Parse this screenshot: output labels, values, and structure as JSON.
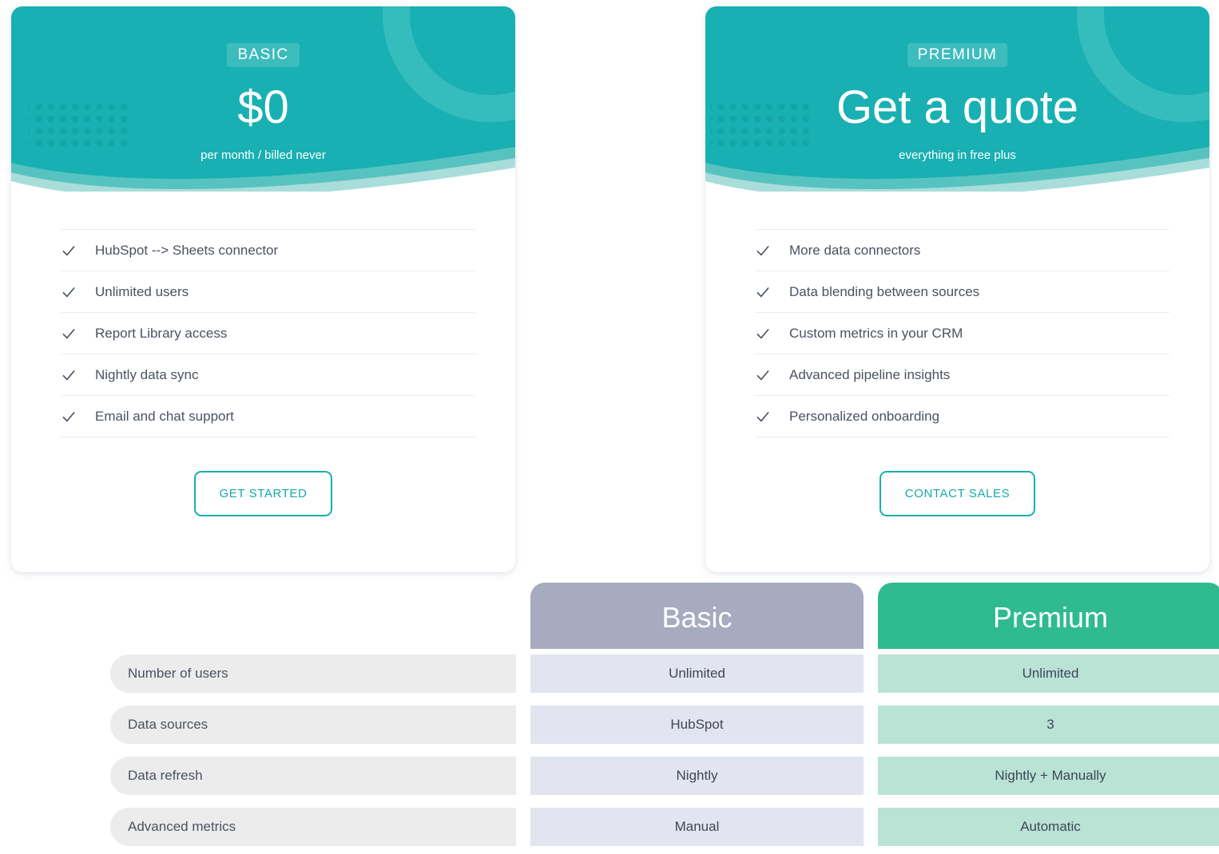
{
  "theme": {
    "teal": "#18b0b2",
    "teal_dark": "#139fa1",
    "teal_mid": "#57c3c0",
    "teal_light": "#a8ddda",
    "gray_header": "#a7abc0",
    "green_header": "#2fba90",
    "basic_cell": "#e2e5ef",
    "premium_cell": "#b9e3d5",
    "label_cell": "#ececec",
    "text": "#4a5260"
  },
  "plans": [
    {
      "id": "basic",
      "badge": "BASIC",
      "price": "$0",
      "subtitle": "per month / billed never",
      "features": [
        "HubSpot --> Sheets connector",
        "Unlimited users",
        "Report Library access",
        "Nightly data sync",
        "Email and chat support"
      ],
      "cta": "GET STARTED",
      "check_icon": "check-icon"
    },
    {
      "id": "premium",
      "badge": "PREMIUM",
      "price": "Get a quote",
      "subtitle": "everything in free plus",
      "features": [
        "More data connectors",
        "Data blending between sources",
        "Custom metrics in your CRM",
        "Advanced pipeline insights",
        "Personalized onboarding"
      ],
      "cta": "CONTACT SALES",
      "check_icon": "check-icon"
    }
  ],
  "comparison": {
    "columns": [
      "Basic",
      "Premium"
    ],
    "rows": [
      {
        "label": "Number of users",
        "basic": "Unlimited",
        "premium": "Unlimited"
      },
      {
        "label": "Data sources",
        "basic": "HubSpot",
        "premium": "3"
      },
      {
        "label": "Data refresh",
        "basic": "Nightly",
        "premium": "Nightly + Manually"
      },
      {
        "label": "Advanced metrics",
        "basic": "Manual",
        "premium": "Automatic"
      }
    ]
  }
}
